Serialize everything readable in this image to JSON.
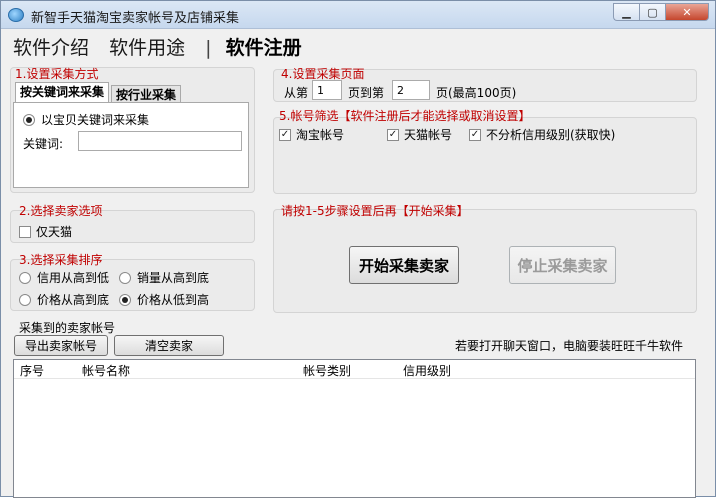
{
  "window": {
    "title": "新智手天猫淘宝卖家帐号及店铺采集"
  },
  "nav": {
    "items": [
      "软件介绍",
      "软件用途",
      "软件注册"
    ],
    "separator": "|"
  },
  "section1": {
    "title": "1.设置采集方式",
    "tabs": [
      "按关键词来采集",
      "按行业采集"
    ],
    "radio_label": "以宝贝关键词来采集",
    "radio_selected": true,
    "keyword_label": "关键词:",
    "keyword_value": ""
  },
  "section2": {
    "title": "2.选择卖家选项",
    "tmall_only_label": "仅天猫",
    "tmall_only_checked": false
  },
  "section3": {
    "title": "3.选择采集排序",
    "options": [
      {
        "label": "信用从高到低",
        "selected": false
      },
      {
        "label": "销量从高到底",
        "selected": false
      },
      {
        "label": "价格从高到底",
        "selected": false
      },
      {
        "label": "价格从低到高",
        "selected": true
      }
    ]
  },
  "section4": {
    "title": "4.设置采集页面",
    "from_label": "从第",
    "from_value": "1",
    "to_label": "页到第",
    "to_value": "2",
    "suffix_label": "页(最高100页)"
  },
  "section5": {
    "title": "5.帐号筛选【软件注册后才能选择或取消设置】",
    "checks": [
      {
        "label": "淘宝帐号",
        "checked": true
      },
      {
        "label": "天猫帐号",
        "checked": true
      },
      {
        "label": "不分析信用级别(获取快)",
        "checked": true
      }
    ]
  },
  "action": {
    "title": "请按1-5步骤设置后再【开始采集】",
    "start_label": "开始采集卖家",
    "stop_label": "停止采集卖家"
  },
  "results": {
    "title": "采集到的卖家帐号",
    "export_label": "导出卖家帐号",
    "clear_label": "清空卖家",
    "hint": "若要打开聊天窗口，电脑要装旺旺千牛软件",
    "columns": [
      "序号",
      "帐号名称",
      "帐号类别",
      "信用级别"
    ],
    "rows": []
  },
  "colors": {
    "section_title": "#c00000",
    "panel_bg": "#ebebeb",
    "window_bg": "#f0f0f0"
  }
}
